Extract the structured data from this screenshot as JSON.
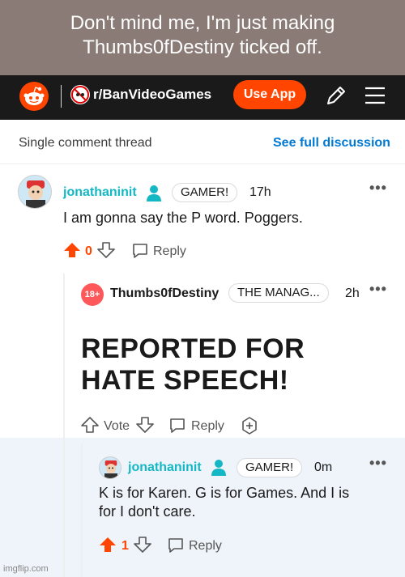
{
  "caption": "Don't mind me, I'm just making Thumbs0fDestiny ticked off.",
  "topbar": {
    "subreddit": "r/BanVideoGames",
    "use_app": "Use App",
    "brand_color": "#ff4500"
  },
  "thread": {
    "title": "Single comment thread",
    "see_full": "See full discussion"
  },
  "comments": [
    {
      "username": "jonathaninit",
      "flair": "GAMER!",
      "time": "17h",
      "body": "I am gonna say the P word. Poggers.",
      "score": "0",
      "reply_label": "Reply"
    },
    {
      "username": "Thumbs0fDestiny",
      "badge": "18+",
      "flair": "THE MANAG...",
      "time": "2h",
      "body_line1": "REPORTED FOR",
      "body_line2": "HATE SPEECH!",
      "vote_label": "Vote",
      "reply_label": "Reply"
    },
    {
      "username": "jonathaninit",
      "flair": "GAMER!",
      "time": "0m",
      "body_line1": "K is for Karen. G is for Games. And I is",
      "body_line2": "for I don't care.",
      "score": "1",
      "reply_label": "Reply"
    }
  ],
  "watermark": "imgflip.com"
}
